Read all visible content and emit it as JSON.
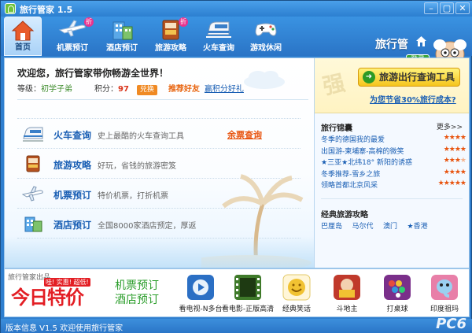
{
  "window": {
    "title": "旅行管家 1.5",
    "buttons": [
      "–",
      "▢",
      "✕"
    ]
  },
  "nav": [
    {
      "label": "首页",
      "icon": "home-icon",
      "active": true
    },
    {
      "label": "机票预订",
      "icon": "airplane-icon",
      "badge": "折"
    },
    {
      "label": "酒店预订",
      "icon": "hotel-icon"
    },
    {
      "label": "旅游攻略",
      "icon": "guidebook-icon",
      "badge": "折"
    },
    {
      "label": "火车查询",
      "icon": "train-icon"
    },
    {
      "label": "游戏休闲",
      "icon": "gamepad-icon"
    }
  ],
  "brand": {
    "name": "旅行管",
    "login_label": "登录"
  },
  "welcome": {
    "message": "欢迎您，旅行管家带你畅游全世界！",
    "level_label": "等级：",
    "level_value": "初学子弟",
    "points_label": "积分：",
    "points_value": "97",
    "exchange_label": "兑换",
    "refer_label": "推荐好友",
    "gift_label": "赢积分好礼"
  },
  "features": [
    {
      "name": "火车查询",
      "desc": "史上最酷的火车查询工具",
      "link": "余票查询",
      "icon": "train-icon"
    },
    {
      "name": "旅游攻略",
      "desc": "好玩，省钱的旅游密笈",
      "icon": "guidebook-icon"
    },
    {
      "name": "机票预订",
      "desc": "特价机票，打折机票",
      "icon": "airplane-icon"
    },
    {
      "name": "酒店预订",
      "desc": "全国8000家酒店预定，厚返",
      "icon": "hotel-icon"
    }
  ],
  "right": {
    "watermark": "强",
    "query_button": "旅游出行查询工具",
    "save_link": "为您节省30%旅行成本?",
    "tips_title": "旅行锦囊",
    "more_label": "更多>>",
    "tips": [
      {
        "text": "冬季的德国我的最爱",
        "stars": 4
      },
      {
        "text": "出国游-柬埔寨-高棉的微笑",
        "stars": 4
      },
      {
        "text": "★三亚★北纬18° 新阳的诱惑",
        "stars": 3.5
      },
      {
        "text": "冬季推荐-雪乡之旅",
        "stars": 4
      },
      {
        "text": "领略首都北京风采",
        "stars": 5
      }
    ],
    "guides_title": "经典旅游攻略",
    "guides": [
      "巴厘岛",
      "马尔代",
      "澳门",
      "★香港"
    ]
  },
  "ads": {
    "caption": "旅行管家出品",
    "jinri": "今日特价",
    "jinri_tag": "哇! 实惠! 超低!",
    "promo_line1": "机票预订",
    "promo_line2": "酒店预订",
    "apps": [
      {
        "label": "看电视-N多台",
        "icon": "tv-player-icon",
        "color": "#2b6fc4"
      },
      {
        "label": "看电影-正版高清",
        "icon": "film-icon",
        "color": "#3f7a2a"
      },
      {
        "label": "经典笑话",
        "icon": "smiley-icon",
        "color": "#f1c232"
      },
      {
        "label": "斗地主",
        "icon": "cards-game-icon",
        "color": "#c0392b"
      },
      {
        "label": "打桌球",
        "icon": "billiards-icon",
        "color": "#7a2f8a"
      },
      {
        "label": "印度祖玛",
        "icon": "elephant-icon",
        "color": "#e87fa8"
      }
    ]
  },
  "status": {
    "text": "版本信息  V1.5  欢迎使用旅行管家",
    "watermark": "PC6"
  }
}
